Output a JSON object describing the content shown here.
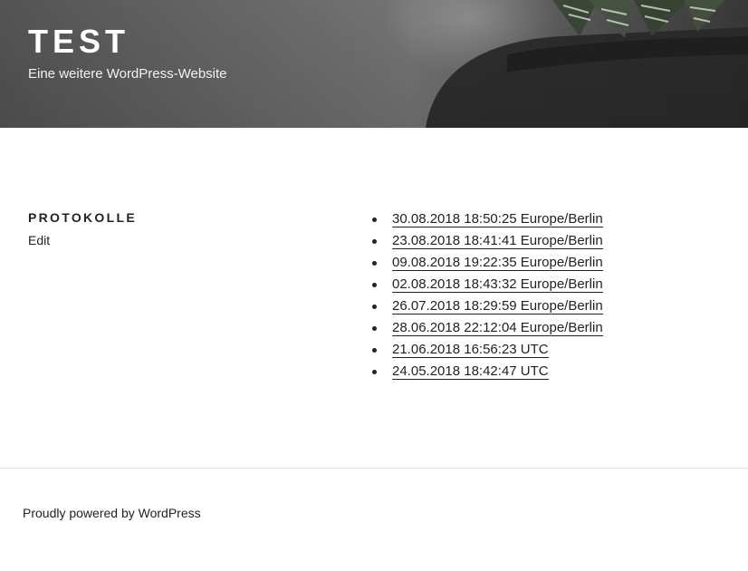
{
  "header": {
    "site_title": "TEST",
    "site_description": "Eine weitere WordPress-Website"
  },
  "main": {
    "heading": "PROTOKOLLE",
    "edit_label": "Edit",
    "entries": [
      "30.08.2018 18:50:25 Europe/Berlin",
      "23.08.2018 18:41:41 Europe/Berlin",
      "09.08.2018 19:22:35 Europe/Berlin",
      "02.08.2018 18:43:32 Europe/Berlin",
      "26.07.2018 18:29:59 Europe/Berlin",
      "28.06.2018 22:12:04 Europe/Berlin",
      "21.06.2018 16:56:23 UTC",
      "24.05.2018 18:42:47 UTC"
    ]
  },
  "footer": {
    "credit": "Proudly powered by WordPress"
  }
}
